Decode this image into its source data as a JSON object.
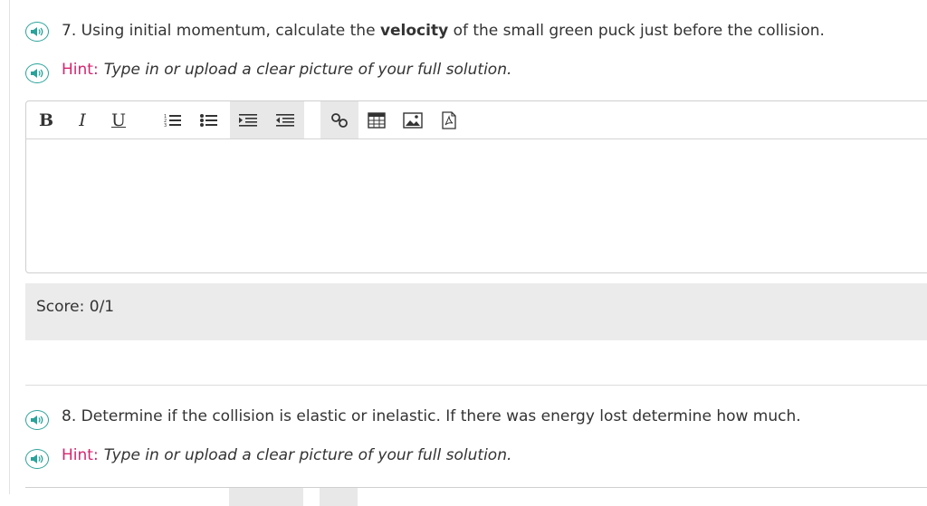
{
  "q7": {
    "number": "7.",
    "before": "Using initial momentum, calculate the ",
    "bold": "velocity",
    "after": " of the small green puck just before the collision."
  },
  "hint7": {
    "label": "Hint:",
    "text": "Type in or upload a clear picture of your full solution."
  },
  "toolbar": {
    "bold": "B",
    "italic": "I",
    "underline": "U"
  },
  "score": {
    "label": "Score:",
    "value": "0/1"
  },
  "q8": {
    "number": "8.",
    "text": "Determine if the collision is elastic or inelastic. If there was energy lost determine how much."
  },
  "hint8": {
    "label": "Hint:",
    "text": "Type in or upload a clear picture of your full solution."
  },
  "icons": {
    "speaker": "speaker-icon",
    "ordered_list": "ordered-list-icon",
    "unordered_list": "unordered-list-icon",
    "indent": "indent-icon",
    "outdent": "outdent-icon",
    "link": "link-icon",
    "table": "table-icon",
    "image": "image-icon",
    "pdf": "pdf-icon"
  },
  "colors": {
    "accent": "#2aa39a",
    "hint": "#d6246e"
  }
}
